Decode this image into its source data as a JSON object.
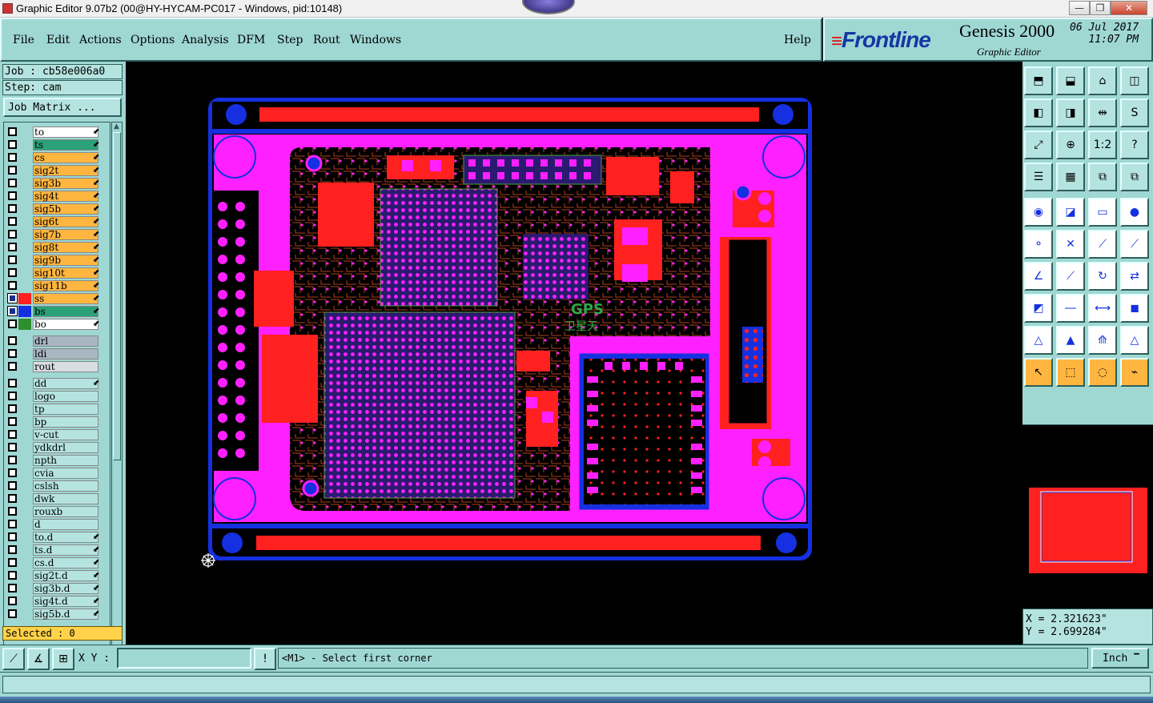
{
  "window": {
    "title": "Graphic Editor 9.07b2 (00@HY-HYCAM-PC017 - Windows, pid:10148)",
    "minimize": "—",
    "restore": "❐",
    "close": "✕"
  },
  "menu": {
    "items": [
      "File",
      "Edit",
      "Actions",
      "Options",
      "Analysis",
      "DFM",
      "Step",
      "Rout",
      "Windows"
    ],
    "help": "Help"
  },
  "brand": {
    "logo": "Frontline",
    "product": "Genesis 2000",
    "subtitle": "Graphic Editor",
    "date": "06 Jul 2017",
    "time": "11:07 PM"
  },
  "job": {
    "job_line": "Job : cb58e006a0",
    "step_line": "Step: cam",
    "matrix_button": "Job Matrix ..."
  },
  "layers": [
    {
      "name": "to",
      "bg": "#ffffff",
      "swatch": "",
      "checked": false,
      "editable": true
    },
    {
      "name": "ts",
      "bg": "#2aa178",
      "swatch": "",
      "checked": false,
      "editable": true
    },
    {
      "name": "cs",
      "bg": "#ffb640",
      "swatch": "",
      "checked": false,
      "editable": true
    },
    {
      "name": "sig2t",
      "bg": "#ffb640",
      "swatch": "",
      "checked": false,
      "editable": true
    },
    {
      "name": "sig3b",
      "bg": "#ffb640",
      "swatch": "",
      "checked": false,
      "editable": true
    },
    {
      "name": "sig4t",
      "bg": "#ffb640",
      "swatch": "",
      "checked": false,
      "editable": true
    },
    {
      "name": "sig5b",
      "bg": "#ffb640",
      "swatch": "",
      "checked": false,
      "editable": true
    },
    {
      "name": "sig6t",
      "bg": "#ffb640",
      "swatch": "",
      "checked": false,
      "editable": true
    },
    {
      "name": "sig7b",
      "bg": "#ffb640",
      "swatch": "",
      "checked": false,
      "editable": true
    },
    {
      "name": "sig8t",
      "bg": "#ffb640",
      "swatch": "",
      "checked": false,
      "editable": true
    },
    {
      "name": "sig9b",
      "bg": "#ffb640",
      "swatch": "",
      "checked": false,
      "editable": true
    },
    {
      "name": "sig10t",
      "bg": "#ffb640",
      "swatch": "",
      "checked": false,
      "editable": true
    },
    {
      "name": "sig11b",
      "bg": "#ffb640",
      "swatch": "",
      "checked": false,
      "editable": true
    },
    {
      "name": "ss",
      "bg": "#ffb640",
      "swatch": "#ff2020",
      "checked": true,
      "editable": true
    },
    {
      "name": "bs",
      "bg": "#2aa178",
      "swatch": "#1530e0",
      "checked": true,
      "editable": true
    },
    {
      "name": "bo",
      "bg": "#ffffff",
      "swatch": "#2f8f2f",
      "checked": false,
      "editable": true
    },
    {
      "name": "drl",
      "bg": "#a8b6c2",
      "swatch": "",
      "checked": false,
      "editable": false,
      "gap": true
    },
    {
      "name": "ldi",
      "bg": "#a8b6c2",
      "swatch": "",
      "checked": false,
      "editable": false
    },
    {
      "name": "rout",
      "bg": "#d8dde2",
      "swatch": "",
      "checked": false,
      "editable": false
    },
    {
      "name": "dd",
      "bg": "#b5e4e0",
      "swatch": "",
      "checked": false,
      "editable": true,
      "gap": true
    },
    {
      "name": "logo",
      "bg": "#b5e4e0",
      "swatch": "",
      "checked": false,
      "editable": false
    },
    {
      "name": "tp",
      "bg": "#b5e4e0",
      "swatch": "",
      "checked": false,
      "editable": false
    },
    {
      "name": "bp",
      "bg": "#b5e4e0",
      "swatch": "",
      "checked": false,
      "editable": false
    },
    {
      "name": "v-cut",
      "bg": "#b5e4e0",
      "swatch": "",
      "checked": false,
      "editable": false
    },
    {
      "name": "ydkdrl",
      "bg": "#b5e4e0",
      "swatch": "",
      "checked": false,
      "editable": false
    },
    {
      "name": "npth",
      "bg": "#b5e4e0",
      "swatch": "",
      "checked": false,
      "editable": false
    },
    {
      "name": "cvia",
      "bg": "#b5e4e0",
      "swatch": "",
      "checked": false,
      "editable": false
    },
    {
      "name": "cslsh",
      "bg": "#b5e4e0",
      "swatch": "",
      "checked": false,
      "editable": false
    },
    {
      "name": "dwk",
      "bg": "#b5e4e0",
      "swatch": "",
      "checked": false,
      "editable": false
    },
    {
      "name": "rouxb",
      "bg": "#b5e4e0",
      "swatch": "",
      "checked": false,
      "editable": false
    },
    {
      "name": "d",
      "bg": "#b5e4e0",
      "swatch": "",
      "checked": false,
      "editable": false
    },
    {
      "name": "to.d",
      "bg": "#b5e4e0",
      "swatch": "",
      "checked": false,
      "editable": true
    },
    {
      "name": "ts.d",
      "bg": "#b5e4e0",
      "swatch": "",
      "checked": false,
      "editable": true
    },
    {
      "name": "cs.d",
      "bg": "#b5e4e0",
      "swatch": "",
      "checked": false,
      "editable": true
    },
    {
      "name": "sig2t.d",
      "bg": "#b5e4e0",
      "swatch": "",
      "checked": false,
      "editable": true
    },
    {
      "name": "sig3b.d",
      "bg": "#b5e4e0",
      "swatch": "",
      "checked": false,
      "editable": true
    },
    {
      "name": "sig4t.d",
      "bg": "#b5e4e0",
      "swatch": "",
      "checked": false,
      "editable": true
    },
    {
      "name": "sig5b.d",
      "bg": "#b5e4e0",
      "swatch": "",
      "checked": false,
      "editable": true
    }
  ],
  "selected": "Selected : 0",
  "board": {
    "silk_text_1": "GPS",
    "silk_text_2": "卫星天"
  },
  "coords": {
    "x": "X = 2.321623\"",
    "y": "Y = 2.699284\""
  },
  "cmd": {
    "xy_label": "X Y :",
    "xy_value": "",
    "alert": "!",
    "prompt": "<M1> - Select first corner",
    "units": "Inch"
  },
  "tools": {
    "one_to_one": "1:2",
    "help": "?"
  },
  "colors": {
    "panel": "#9fd7d3",
    "layer_ss": "#ff2020",
    "layer_bs": "#1530e0",
    "overlap": "#ff20ff",
    "highlight": "#ffb640"
  }
}
